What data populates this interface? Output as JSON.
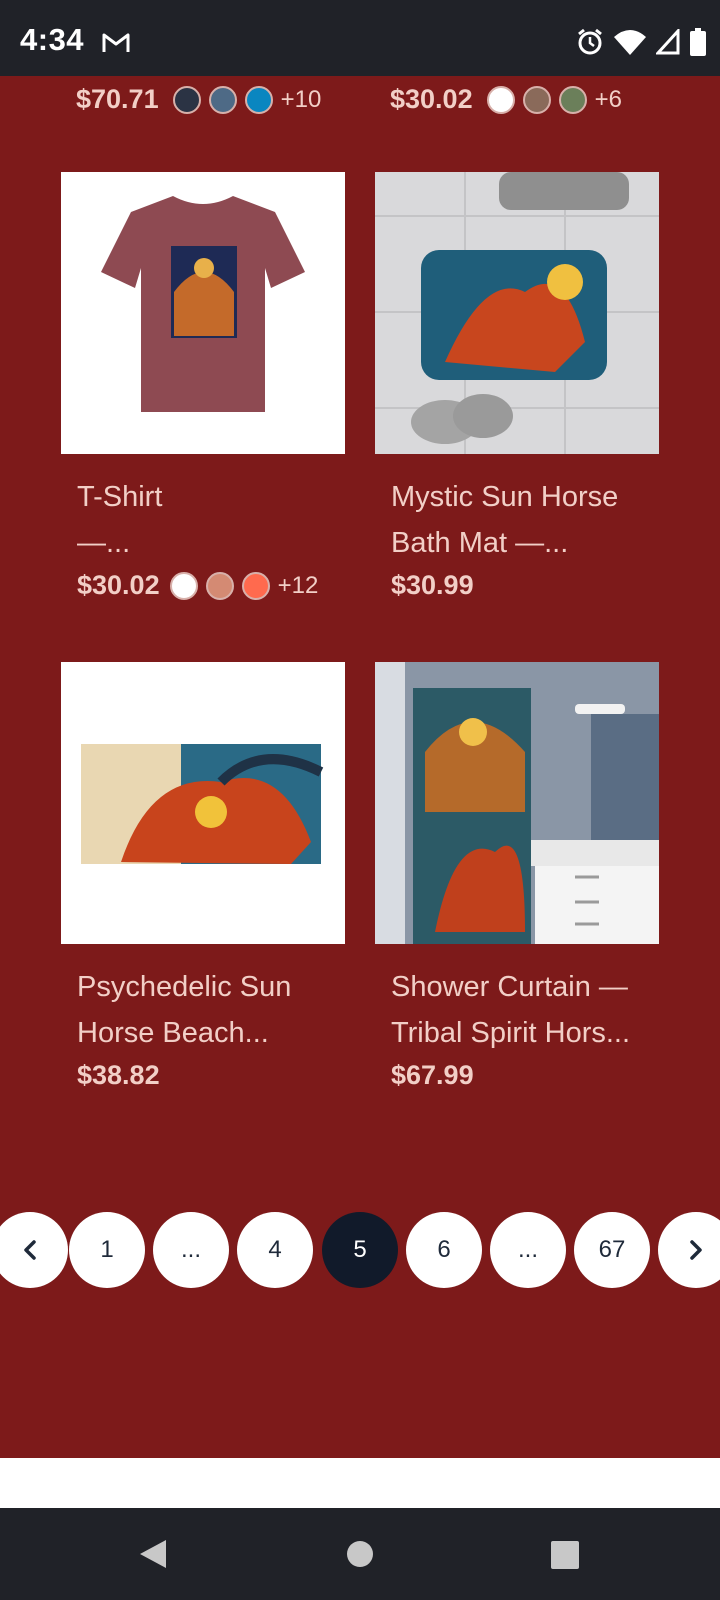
{
  "status_bar": {
    "time": "4:34"
  },
  "top_row": [
    {
      "price": "$70.71",
      "swatches": [
        "#2b3344",
        "#4e6a86",
        "#0a86c0"
      ],
      "more": "+10"
    },
    {
      "price": "$30.02",
      "swatches": [
        "#ffffff",
        "#8a6a5a",
        "#6b7f5a"
      ],
      "more": "+6"
    }
  ],
  "products": [
    {
      "title_lines": [
        "T-Shirt",
        "—..."
      ],
      "price": "$30.02",
      "swatches": [
        "#ffffff",
        "#d48a73",
        "#ff6a4e"
      ],
      "more": "+12"
    },
    {
      "title_lines": [
        "Mystic Sun Horse",
        "Bath Mat —..."
      ],
      "price": "$30.99"
    },
    {
      "title_lines": [
        "Psychedelic Sun",
        "Horse Beach..."
      ],
      "price": "$38.82"
    },
    {
      "title_lines": [
        "Shower Curtain —",
        "Tribal Spirit Hors..."
      ],
      "price": "$67.99"
    }
  ],
  "pagination": {
    "prev_icon": "chevron-left-icon",
    "next_icon": "chevron-right-icon",
    "pages": [
      "1",
      "...",
      "4",
      "5",
      "6",
      "...",
      "67"
    ],
    "current": "5"
  }
}
